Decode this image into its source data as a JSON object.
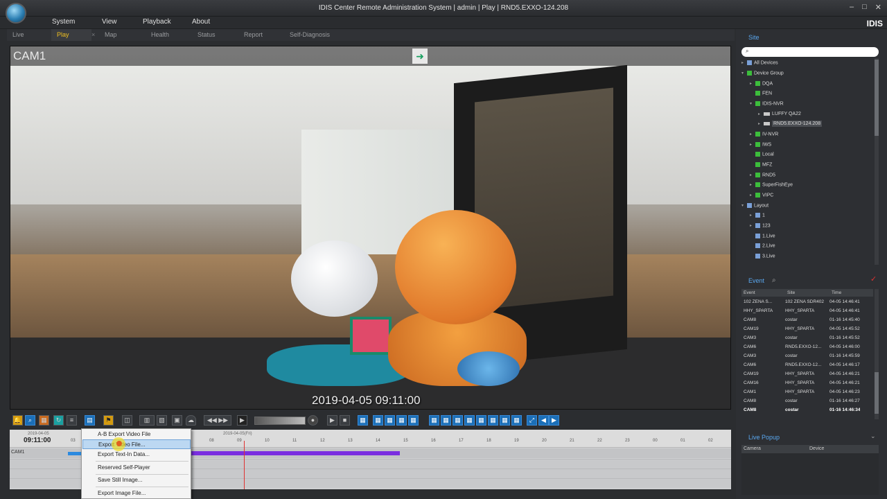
{
  "window": {
    "title": "IDIS Center Remote Administration System | admin | Play | RND5.EXXO-124.208",
    "controls": [
      "–",
      "□",
      "✕"
    ],
    "brand": "IDIS"
  },
  "menu": [
    "System",
    "View",
    "Playback",
    "About"
  ],
  "tabs": [
    {
      "label": "Live",
      "active": false
    },
    {
      "label": "Play",
      "active": true
    },
    {
      "label": "Map",
      "active": false
    },
    {
      "label": "Health",
      "active": false
    },
    {
      "label": "Status",
      "active": false
    },
    {
      "label": "Report",
      "active": false
    },
    {
      "label": "Self-Diagnosis",
      "active": false
    }
  ],
  "tab_close": "×",
  "video": {
    "camera": "CAM1",
    "timestamp": "2019-04-05 09:11:00"
  },
  "toolbar": {
    "left_icons": [
      "alarm-icon",
      "zoom-icon",
      "grid-icon",
      "refresh-icon",
      "list-icon",
      "save-icon",
      "export-icon",
      "camera-icon",
      "layout-icon",
      "layout2-icon",
      "monitor-icon",
      "cloud-icon"
    ],
    "playback": [
      "◀◀",
      "▶▶",
      "▶"
    ],
    "layouts": 18
  },
  "timeline": {
    "date_left": "2019-04-05",
    "time": "09:11:00",
    "date_mid": "2019-04-05(Fri)",
    "hours": [
      "03",
      "08",
      "09",
      "10",
      "11",
      "12",
      "13",
      "14",
      "15",
      "16",
      "17",
      "18",
      "19",
      "20",
      "21",
      "22",
      "23",
      "00",
      "01",
      "02"
    ],
    "row_label": "CAM1"
  },
  "context_menu": {
    "items": [
      {
        "label": "A-B Export Video File",
        "highlight": false
      },
      {
        "label": "Export Video File...",
        "highlight": true
      },
      {
        "label": "Export Text-In Data...",
        "highlight": false
      },
      {
        "label": "Reserved Self-Player",
        "highlight": false
      },
      {
        "label": "Save Still Image...",
        "highlight": false
      },
      {
        "label": "Export Image File...",
        "highlight": false
      }
    ]
  },
  "site": {
    "title": "Site",
    "search_placeholder": "",
    "tree": [
      {
        "label": "All Devices",
        "level": 0,
        "icon": "lay",
        "expander": "▸"
      },
      {
        "label": "Device Group",
        "level": 0,
        "icon": "grp",
        "expander": "▾"
      },
      {
        "label": "DQA",
        "level": 1,
        "icon": "grp",
        "expander": "▸"
      },
      {
        "label": "FEN",
        "level": 1,
        "icon": "grp",
        "expander": ""
      },
      {
        "label": "IDIS-NVR",
        "level": 1,
        "icon": "grp",
        "expander": "▾"
      },
      {
        "label": "LUFFY QA22",
        "level": 2,
        "icon": "dev",
        "expander": "▸"
      },
      {
        "label": "RND5.EXXO-124.208",
        "level": 2,
        "icon": "dev",
        "expander": "▸",
        "selected": true
      },
      {
        "label": "IV-NVR",
        "level": 1,
        "icon": "grp",
        "expander": "▸"
      },
      {
        "label": "IWS",
        "level": 1,
        "icon": "grp",
        "expander": "▸"
      },
      {
        "label": "Local",
        "level": 1,
        "icon": "grp",
        "expander": ""
      },
      {
        "label": "MFZ",
        "level": 1,
        "icon": "grp",
        "expander": ""
      },
      {
        "label": "RND5",
        "level": 1,
        "icon": "grp",
        "expander": "▸"
      },
      {
        "label": "SuperFishEye",
        "level": 1,
        "icon": "grp",
        "expander": "▸"
      },
      {
        "label": "VIPC",
        "level": 1,
        "icon": "grp",
        "expander": "▸"
      },
      {
        "label": "Layout",
        "level": 0,
        "icon": "lay",
        "expander": "▾"
      },
      {
        "label": "1",
        "level": 1,
        "icon": "lay",
        "expander": "▸"
      },
      {
        "label": "123",
        "level": 1,
        "icon": "lay",
        "expander": "▸"
      },
      {
        "label": "1.Live",
        "level": 1,
        "icon": "lay",
        "expander": ""
      },
      {
        "label": "2.Live",
        "level": 1,
        "icon": "lay",
        "expander": ""
      },
      {
        "label": "3.Live",
        "level": 1,
        "icon": "lay",
        "expander": ""
      }
    ]
  },
  "event": {
    "title": "Event",
    "columns": [
      "Event",
      "Site",
      "Time"
    ],
    "rows": [
      {
        "event": "102 ZENA S...",
        "site": "102 ZENA SDR402",
        "time": "04-05 14:46:41",
        "bold": false
      },
      {
        "event": "HHY_SPARTA",
        "site": "HHY_SPARTA",
        "time": "04-05 14:46:41",
        "bold": false
      },
      {
        "event": "CAM8",
        "site": "costar",
        "time": "01-16 14:45:40",
        "bold": false
      },
      {
        "event": "CAM19",
        "site": "HHY_SPARTA",
        "time": "04-05 14:45:52",
        "bold": false
      },
      {
        "event": "CAM3",
        "site": "costar",
        "time": "01-16 14:45:52",
        "bold": false
      },
      {
        "event": "CAM6",
        "site": "RND5.EXXO-12...",
        "time": "04-05 14:46:00",
        "bold": false
      },
      {
        "event": "CAM3",
        "site": "costar",
        "time": "01-16 14:45:59",
        "bold": false
      },
      {
        "event": "CAM6",
        "site": "RND5.EXXO-12...",
        "time": "04-05 14:46:17",
        "bold": false
      },
      {
        "event": "CAM19",
        "site": "HHY_SPARTA",
        "time": "04-05 14:46:21",
        "bold": false
      },
      {
        "event": "CAM16",
        "site": "HHY_SPARTA",
        "time": "04-05 14:46:21",
        "bold": false
      },
      {
        "event": "CAM1",
        "site": "HHY_SPARTA",
        "time": "04-05 14:46:23",
        "bold": false
      },
      {
        "event": "CAM8",
        "site": "costar",
        "time": "01-16 14:46:27",
        "bold": false
      },
      {
        "event": "CAM8",
        "site": "costar",
        "time": "01-16 14:46:34",
        "bold": true
      }
    ]
  },
  "live_popup": {
    "title": "Live Popup",
    "columns": [
      "Camera",
      "Device"
    ]
  }
}
